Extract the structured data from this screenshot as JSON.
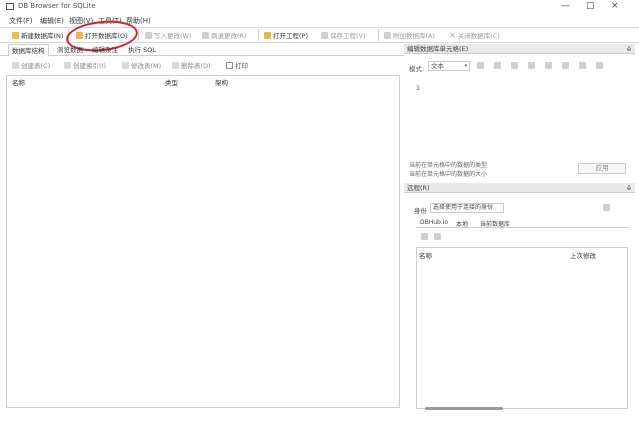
{
  "window": {
    "title": "DB Browser for SQLite",
    "minimize": "—",
    "maximize": "□",
    "close": "×"
  },
  "menu": [
    "文件(F)",
    "编辑(E)",
    "视图(V)",
    "工具(T)",
    "帮助(H)"
  ],
  "toolbar": {
    "new_db": "新建数据库(N)",
    "open_db": "打开数据库(O)",
    "write_changes": "写入更改(W)",
    "revert_changes": "倒退更改(R)",
    "open_project": "打开工程(P)",
    "save_project": "保存工程(V)",
    "attach_db": "附加数据库(A)",
    "close_db": "关闭数据库(C)"
  },
  "tabs": [
    "数据库结构",
    "浏览数据",
    "编辑杂注",
    "执行 SQL"
  ],
  "subtoolbar": {
    "create_table": "创建表(C)",
    "create_index": "创建索引(I)",
    "modify_table": "修改表(M)",
    "delete_table": "删除表(D)",
    "print": "打印"
  },
  "columns": {
    "name": "名称",
    "type": "类型",
    "schema": "架构"
  },
  "edit_cell": {
    "header": "编辑数据库单元格(E)",
    "mode_label": "模式:",
    "mode_value": "文本",
    "line_number": "1",
    "status_type": "当前在单元格中的数据的类型",
    "status_size": "当前在单元格中的数据的大小",
    "apply": "应用"
  },
  "remote": {
    "header": "远程(R)",
    "identity_label": "身份",
    "identity_value": "选择使用于连接的身份",
    "tabs": [
      "DBHub.io",
      "本地",
      "当前数据库"
    ],
    "col_name": "名称",
    "col_last_modified": "上次修改"
  },
  "colors": {
    "annotation": "#d4202a",
    "panel_header": "#e9e9e9"
  }
}
